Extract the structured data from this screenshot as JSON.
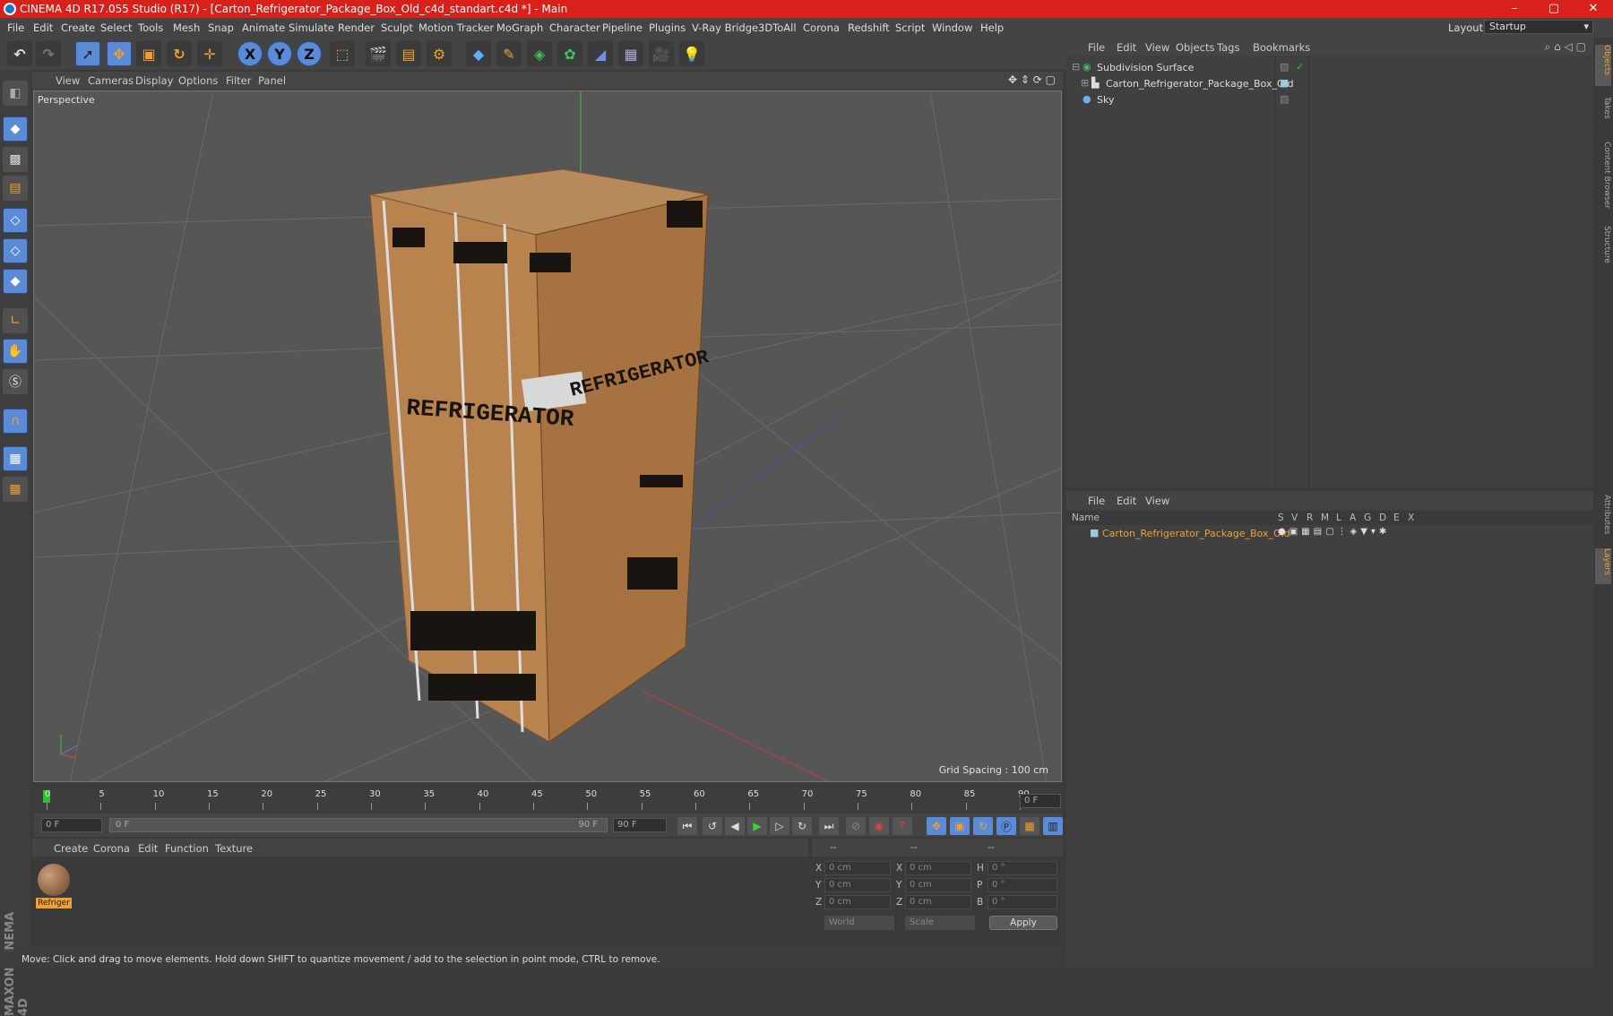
{
  "titlebar": {
    "title": "CINEMA 4D R17.055 Studio (R17) - [Carton_Refrigerator_Package_Box_Old_c4d_standart.c4d *] - Main",
    "minimize": "–",
    "maximize": "▢",
    "close": "✕"
  },
  "menu": [
    "File",
    "Edit",
    "Create",
    "Select",
    "Tools",
    "Mesh",
    "Snap",
    "Animate",
    "Simulate",
    "Render",
    "Sculpt",
    "Motion Tracker",
    "MoGraph",
    "Character",
    "Pipeline",
    "Plugins",
    "V-Ray Bridge",
    "3DToAll",
    "Corona",
    "Redshift",
    "Script",
    "Window",
    "Help"
  ],
  "layout": {
    "label": "Layout:",
    "value": "Startup"
  },
  "toolbar": {
    "x": "X",
    "y": "Y",
    "z": "Z"
  },
  "viewport": {
    "menu": [
      "View",
      "Cameras",
      "Display",
      "Options",
      "Filter",
      "Panel"
    ],
    "label": "Perspective",
    "grid_spacing": "Grid Spacing : 100 cm",
    "box_text_front": "REFRIGERATOR",
    "box_text_side": "REFRIGERATOR"
  },
  "timeline": {
    "ticks": [
      "0",
      "5",
      "10",
      "15",
      "20",
      "25",
      "30",
      "35",
      "40",
      "45",
      "50",
      "55",
      "60",
      "65",
      "70",
      "75",
      "80",
      "85",
      "90"
    ],
    "current": "0 F"
  },
  "transport": {
    "start": "0 F",
    "range_start": "0 F",
    "range_end": "90 F",
    "end": "90 F"
  },
  "materials": {
    "menu": [
      "Create",
      "Corona",
      "Edit",
      "Function",
      "Texture"
    ],
    "items": [
      {
        "name": "Refriger"
      }
    ]
  },
  "coords": {
    "headers": [
      "--",
      "--",
      "--"
    ],
    "rows": [
      {
        "a": "X",
        "av": "0 cm",
        "b": "X",
        "bv": "0 cm",
        "c": "H",
        "cv": "0 °"
      },
      {
        "a": "Y",
        "av": "0 cm",
        "b": "Y",
        "bv": "0 cm",
        "c": "P",
        "cv": "0 °"
      },
      {
        "a": "Z",
        "av": "0 cm",
        "b": "Z",
        "bv": "0 cm",
        "c": "B",
        "cv": "0 °"
      }
    ],
    "world": "World",
    "scale": "Scale",
    "apply": "Apply"
  },
  "status": "Move: Click and drag to move elements. Hold down SHIFT to quantize movement / add to the selection in point mode, CTRL to remove.",
  "objects": {
    "menu": [
      "File",
      "Edit",
      "View",
      "Objects",
      "Tags",
      "Bookmarks"
    ],
    "items": [
      {
        "name": "Subdivision Surface",
        "level": 0
      },
      {
        "name": "Carton_Refrigerator_Package_Box_Old",
        "level": 1
      },
      {
        "name": "Sky",
        "level": 0
      }
    ]
  },
  "layers": {
    "menu": [
      "File",
      "Edit",
      "View"
    ],
    "headers": [
      "Name",
      "S",
      "V",
      "R",
      "M",
      "L",
      "A",
      "G",
      "D",
      "E",
      "X"
    ],
    "items": [
      {
        "name": "Carton_Refrigerator_Package_Box_Old"
      }
    ]
  },
  "side_tabs": [
    "Objects",
    "Takes",
    "Content Browser",
    "Structure",
    "Attributes",
    "Layers"
  ],
  "brand": "MAXON CINEMA 4D",
  "colors": {
    "accent": "#d9211c",
    "selected_orange": "#f0a030",
    "tool_blue": "#5b8ad6"
  }
}
